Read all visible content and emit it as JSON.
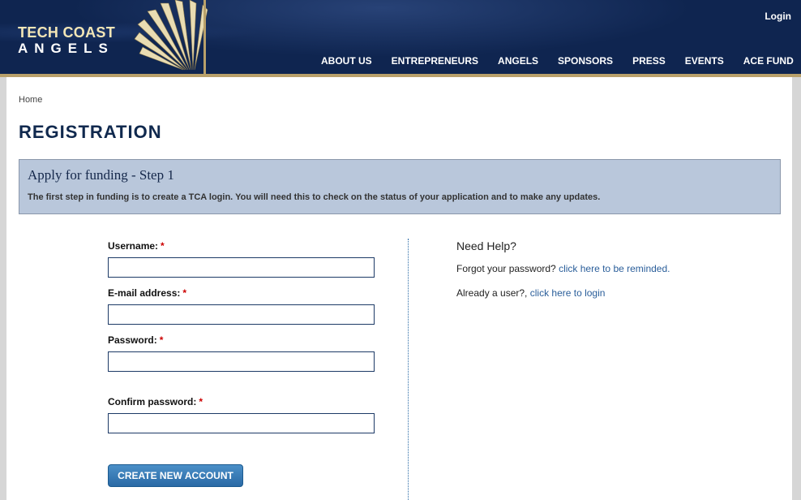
{
  "header": {
    "logo_line1": "TECH COAST",
    "logo_line2": "ANGELS",
    "login_label": "Login",
    "nav": [
      {
        "label": "ABOUT US"
      },
      {
        "label": "ENTREPRENEURS"
      },
      {
        "label": "ANGELS"
      },
      {
        "label": "SPONSORS"
      },
      {
        "label": "PRESS"
      },
      {
        "label": "EVENTS"
      },
      {
        "label": "ACE FUND"
      }
    ]
  },
  "breadcrumb": "Home",
  "page_title": "REGISTRATION",
  "info": {
    "title": "Apply for funding - Step 1",
    "text": "The first step in funding is to create a TCA login. You will need this to check on the status of your application and to make any updates."
  },
  "form": {
    "username_label": "Username:",
    "email_label": "E-mail address:",
    "password_label": "Password:",
    "confirm_label": "Confirm password:",
    "required_mark": "*",
    "username_value": "",
    "email_value": "",
    "password_value": "",
    "confirm_value": "",
    "submit_label": "CREATE NEW ACCOUNT"
  },
  "help": {
    "title": "Need Help?",
    "forgot_text": "Forgot your password?",
    "forgot_link": "click here to be reminded.",
    "user_text": "Already a user?,",
    "login_link": "click here to login"
  },
  "colors": {
    "header_bg": "#0f2550",
    "gold": "#b8a06a",
    "title_navy": "#10294e",
    "info_bg": "#b9c7db",
    "link_blue": "#2a5e9a",
    "button_blue": "#2a6aa5",
    "required_red": "#cc0000"
  }
}
